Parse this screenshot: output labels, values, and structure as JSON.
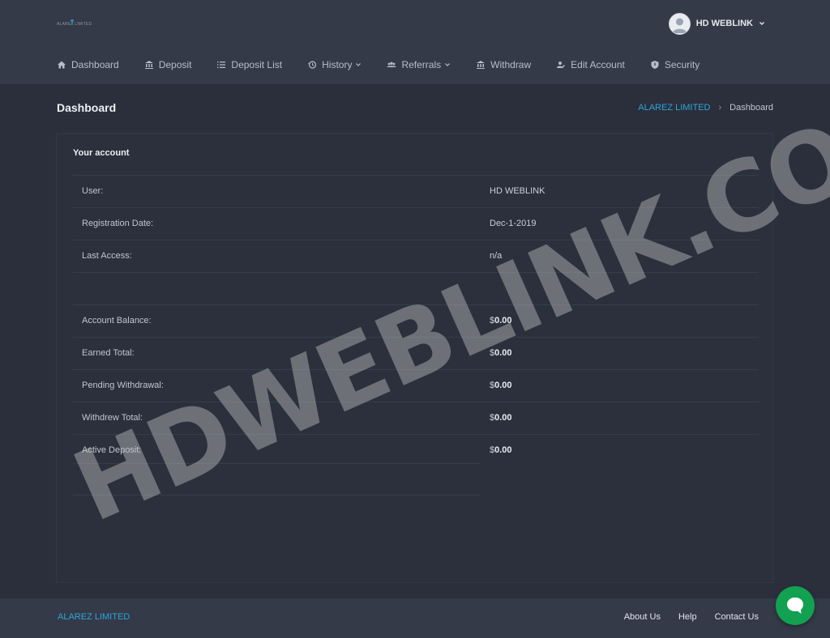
{
  "header": {
    "logo_text": "ALAREZ LIMITED",
    "user_name": "HD WEBLINK",
    "nav": [
      {
        "label": "Dashboard",
        "icon": "home-icon"
      },
      {
        "label": "Deposit",
        "icon": "bank-icon"
      },
      {
        "label": "Deposit List",
        "icon": "list-icon"
      },
      {
        "label": "History",
        "icon": "history-icon",
        "dropdown": true
      },
      {
        "label": "Referrals",
        "icon": "users-icon",
        "dropdown": true
      },
      {
        "label": "Withdraw",
        "icon": "bank-icon"
      },
      {
        "label": "Edit Account",
        "icon": "user-edit-icon"
      },
      {
        "label": "Security",
        "icon": "shield-icon"
      }
    ]
  },
  "page": {
    "title": "Dashboard",
    "breadcrumb_link": "ALAREZ LIMITED",
    "breadcrumb_sep": "›",
    "breadcrumb_current": "Dashboard"
  },
  "account": {
    "title": "Your account",
    "rows": [
      {
        "label": "User:",
        "value": "HD WEBLINK"
      },
      {
        "label": "Registration Date:",
        "value": "Dec-1-2019"
      },
      {
        "label": "Last Access:",
        "value": "n/a"
      },
      {
        "label": "",
        "value": ""
      },
      {
        "label": "Account Balance:",
        "currency": "$",
        "amount": "0.00"
      },
      {
        "label": "Earned Total:",
        "currency": "$",
        "amount": "0.00"
      },
      {
        "label": "Pending Withdrawal:",
        "currency": "$",
        "amount": "0.00"
      },
      {
        "label": "Withdrew Total:",
        "currency": "$",
        "amount": "0.00"
      },
      {
        "label": "Active Deposit:",
        "currency": "$",
        "amount": "0.00"
      }
    ]
  },
  "watermark": "HDWEBLINK.COM",
  "footer": {
    "brand": "ALAREZ LIMITED",
    "links": [
      "About Us",
      "Help",
      "Contact Us"
    ]
  },
  "colors": {
    "accent": "#2ea5d9",
    "chat": "#12a151",
    "background": "#2a2f3b",
    "header": "#343a48"
  }
}
